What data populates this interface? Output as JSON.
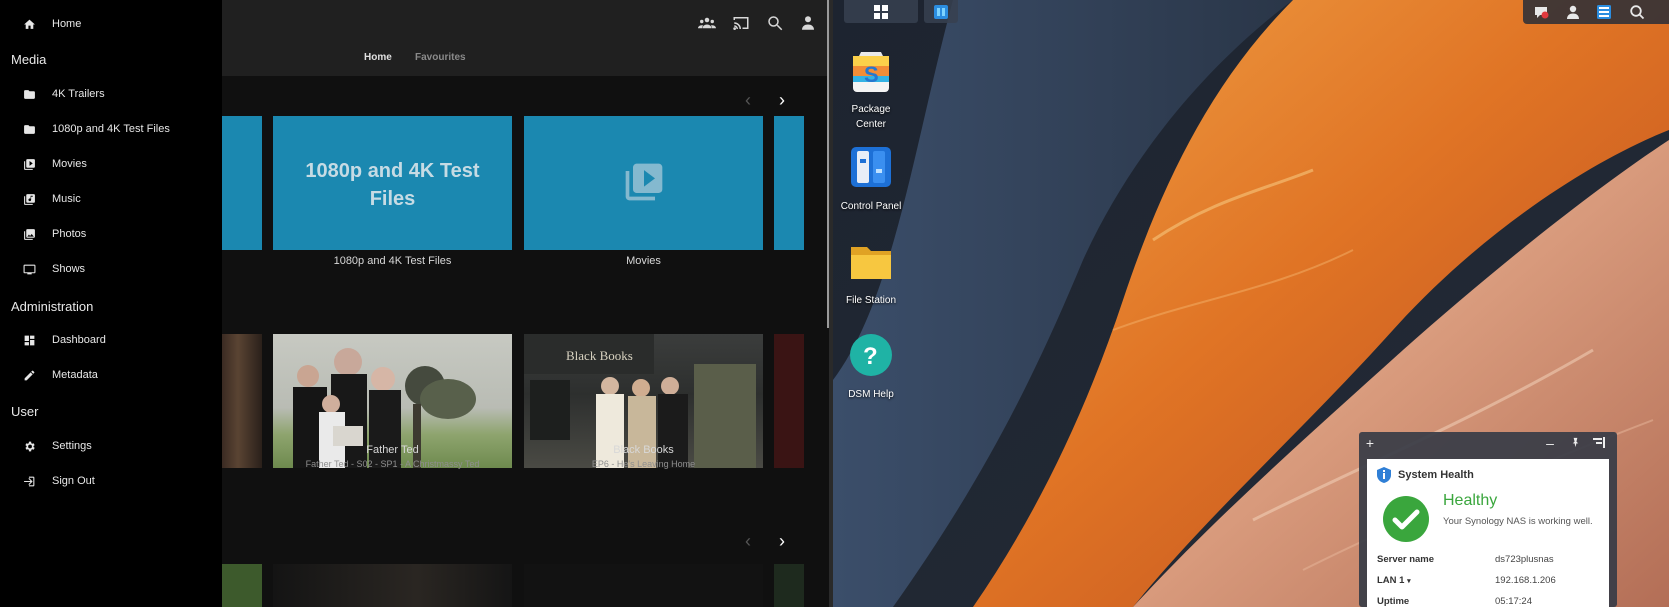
{
  "media_app": {
    "header_tabs": [
      {
        "label": "Home"
      },
      {
        "label": "Favourites"
      }
    ],
    "header_icons": [
      "users-icon",
      "cast-icon",
      "search-icon",
      "account-icon"
    ],
    "sidebar": {
      "home_label": "Home",
      "sections": [
        {
          "title": "Media",
          "items": [
            {
              "label": "4K Trailers",
              "icon": "folder-icon"
            },
            {
              "label": "1080p and 4K Test Files",
              "icon": "folder-icon"
            },
            {
              "label": "Movies",
              "icon": "video-library-icon"
            },
            {
              "label": "Music",
              "icon": "library-music-icon"
            },
            {
              "label": "Photos",
              "icon": "photo-library-icon"
            },
            {
              "label": "Shows",
              "icon": "tv-icon"
            }
          ]
        },
        {
          "title": "Administration",
          "items": [
            {
              "label": "Dashboard",
              "icon": "dashboard-icon"
            },
            {
              "label": "Metadata",
              "icon": "edit-icon"
            }
          ]
        },
        {
          "title": "User",
          "items": [
            {
              "label": "Settings",
              "icon": "settings-icon"
            },
            {
              "label": "Sign Out",
              "icon": "logout-icon"
            }
          ]
        }
      ]
    },
    "libraries": [
      {
        "card_title": "1080p and 4K Test Files",
        "label": "1080p and 4K Test Files"
      },
      {
        "card_title": "",
        "label": "Movies"
      }
    ],
    "continue_watching": [
      {
        "title": "Father Ted",
        "subtitle": "Father Ted - S02 - SP1 - A Christmassy Ted"
      },
      {
        "title": "Black Books",
        "subtitle": "EP6 - He's Leaving Home"
      }
    ],
    "colors": {
      "library_card": "#1b88b0",
      "background": "#101010",
      "header": "#202020"
    }
  },
  "nas_desktop": {
    "icons": [
      {
        "label": "Package Center"
      },
      {
        "label": "Control Panel"
      },
      {
        "label": "File Station"
      },
      {
        "label": "DSM Help"
      }
    ],
    "widget": {
      "title": "System Health",
      "status": "Healthy",
      "message": "Your Synology NAS is working well.",
      "rows": [
        {
          "key": "Server name",
          "value": "ds723plusnas"
        },
        {
          "key": "LAN 1",
          "value": "192.168.1.206"
        },
        {
          "key": "Uptime",
          "value": "05:17:24"
        }
      ]
    },
    "colors": {
      "healthy": "#3aa63d",
      "widget_frame": "#373c46"
    }
  }
}
